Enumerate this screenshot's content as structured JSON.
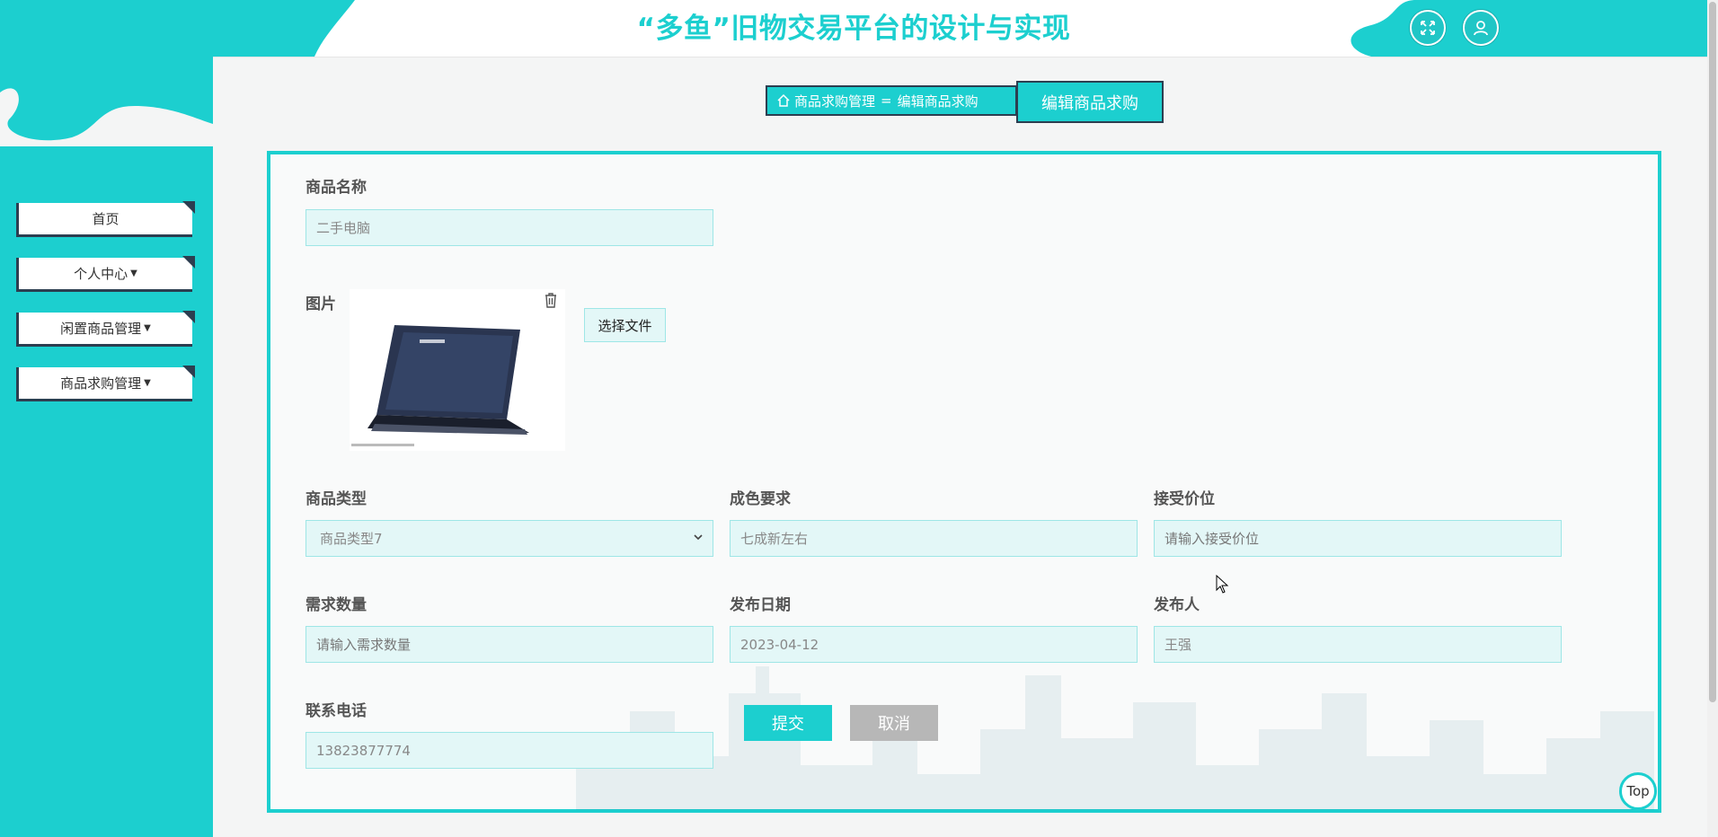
{
  "header": {
    "title": "“多鱼”旧物交易平台的设计与实现",
    "icons": [
      "fullscreen-icon",
      "user-icon"
    ]
  },
  "sidebar": {
    "items": [
      {
        "label": "首页",
        "has_dropdown": false
      },
      {
        "label": "个人中心",
        "has_dropdown": true
      },
      {
        "label": "闲置商品管理",
        "has_dropdown": true
      },
      {
        "label": "商品求购管理",
        "has_dropdown": true
      }
    ]
  },
  "breadcrumb": {
    "home_icon": "home-icon",
    "section": "商品求购管理",
    "separator": "=",
    "page": "编辑商品求购",
    "title": "编辑商品求购"
  },
  "form": {
    "name": {
      "label": "商品名称",
      "value": "二手电脑"
    },
    "image": {
      "label": "图片",
      "choose_label": "选择文件"
    },
    "category": {
      "label": "商品类型",
      "value": "商品类型7"
    },
    "condition": {
      "label": "成色要求",
      "value": "七成新左右"
    },
    "price": {
      "label": "接受价位",
      "placeholder": "请输入接受价位"
    },
    "quantity": {
      "label": "需求数量",
      "placeholder": "请输入需求数量"
    },
    "publish_date": {
      "label": "发布日期",
      "value": "2023-04-12"
    },
    "publisher": {
      "label": "发布人",
      "value": "王强"
    },
    "phone": {
      "label": "联系电话",
      "value": "13823877774"
    },
    "submit_label": "提交",
    "cancel_label": "取消"
  },
  "top_button": {
    "label": "Top"
  },
  "colors": {
    "accent": "#1ccfcf",
    "dark": "#2c3e50",
    "cancel": "#b7b7b7"
  }
}
